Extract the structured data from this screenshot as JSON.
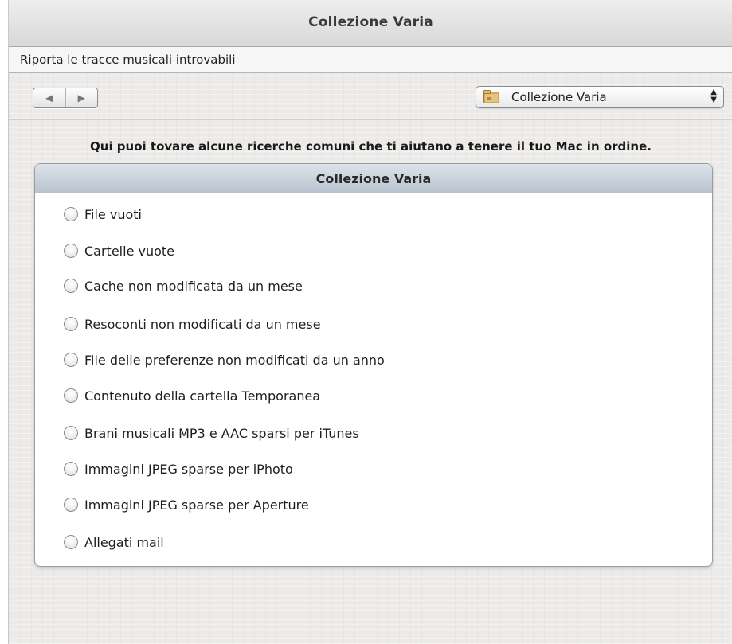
{
  "window": {
    "title": "Collezione Varia"
  },
  "subtitle": "Riporta le tracce musicali introvabili",
  "toolbar": {
    "back_glyph": "◀",
    "forward_glyph": "▶",
    "popup_label": "Collezione Varia",
    "popup_icon": "folder-icon"
  },
  "intro_text": "Qui puoi tovare alcune ricerche comuni che ti aiutano a tenere il tuo Mac in ordine.",
  "panel": {
    "header": "Collezione Varia",
    "options": [
      {
        "label": "File vuoti",
        "selected": false
      },
      {
        "label": "Cartelle vuote",
        "selected": false
      },
      {
        "label": "Cache non modificata da un mese",
        "selected": false
      },
      {
        "label": "Resoconti non modificati da un mese",
        "selected": false
      },
      {
        "label": "File delle preferenze non modificati da un anno",
        "selected": false
      },
      {
        "label": "Contenuto della cartella Temporanea",
        "selected": false
      },
      {
        "label": "Brani musicali MP3 e AAC sparsi per iTunes",
        "selected": false
      },
      {
        "label": "Immagini JPEG sparse per iPhoto",
        "selected": false
      },
      {
        "label": "Immagini JPEG sparse per Aperture",
        "selected": false
      },
      {
        "label": "Allegati mail",
        "selected": false
      }
    ]
  },
  "colors": {
    "window_bg": "#ecebea",
    "panel_header": "#c6ced8",
    "folder": "#c9a25a"
  }
}
